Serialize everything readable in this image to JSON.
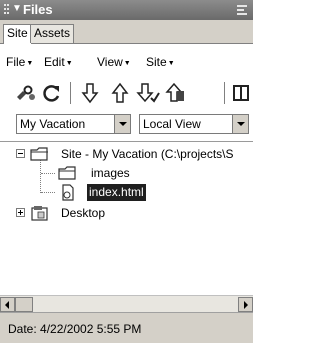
{
  "panel": {
    "title": "Files"
  },
  "tabs": [
    {
      "label": "Site",
      "active": true
    },
    {
      "label": "Assets",
      "active": false
    }
  ],
  "menu": [
    {
      "label": "File"
    },
    {
      "label": "Edit"
    },
    {
      "label": "View"
    },
    {
      "label": "Site"
    }
  ],
  "toolbar": {
    "buttons": [
      "connect-icon",
      "refresh-icon",
      "get-files-icon",
      "put-files-icon",
      "check-out-icon",
      "check-in-icon",
      "expand-icon"
    ]
  },
  "selects": {
    "site": {
      "value": "My Vacation"
    },
    "view": {
      "value": "Local View"
    }
  },
  "tree": {
    "items": [
      {
        "label": "Site - My Vacation (C:\\projects\\S",
        "type": "site-folder",
        "expanded": true
      },
      {
        "label": "images",
        "type": "folder"
      },
      {
        "label": "index.html",
        "type": "file",
        "selected": true
      },
      {
        "label": "Desktop",
        "type": "desktop",
        "expanded": false
      }
    ]
  },
  "status": {
    "text": "Date: 4/22/2002 5:55 PM"
  },
  "colors": {
    "titlebar": "#7a7a7a",
    "selection": "#1f1f1f",
    "chrome": "#d4d0c8"
  }
}
